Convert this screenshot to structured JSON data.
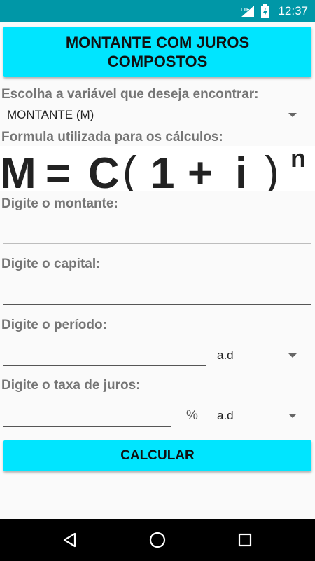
{
  "status_bar": {
    "network": "LTE",
    "time": "12:37"
  },
  "header": {
    "title": "MONTANTE COM JUROS\nCOMPOSTOS"
  },
  "variable_select": {
    "label": "Escolha a variável que deseja encontrar:",
    "selected": "MONTANTE (M)"
  },
  "formula": {
    "label": "Formula utilizada para os cálculos:",
    "lhs": "M",
    "eq": "=",
    "c": "C",
    "open": "(",
    "one": "1",
    "plus": "+",
    "i": "i",
    "close": ")",
    "exp": "n"
  },
  "montante": {
    "label": "Digite o montante:",
    "value": ""
  },
  "capital": {
    "label": "Digite o capital:",
    "value": ""
  },
  "periodo": {
    "label": "Digite o período:",
    "value": "",
    "unit_selected": "a.d"
  },
  "taxa": {
    "label": "Digite o taxa de juros:",
    "value": "",
    "percent_symbol": "%",
    "unit_selected": "a.d"
  },
  "calculate_button": {
    "label": "CALCULAR"
  },
  "nav_bar": {
    "back_icon": "back-triangle-icon",
    "home_icon": "home-circle-icon",
    "recents_icon": "recents-square-icon"
  },
  "colors": {
    "status_bar": "#0097a7",
    "accent_button": "#00e5ff",
    "label_gray": "#757575"
  }
}
